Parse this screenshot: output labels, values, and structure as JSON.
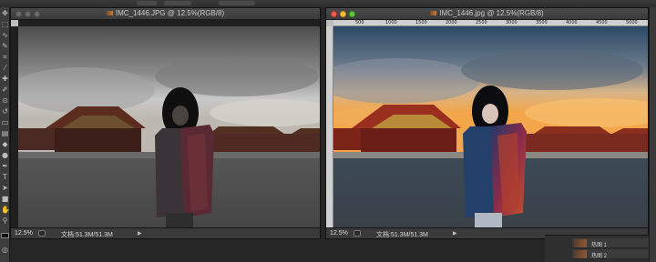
{
  "windows": {
    "left": {
      "title": "IMC_1446.JPG @ 12.5%(RGB/8)",
      "zoom": "12.5%",
      "doc_info": "文档:51.3M/51.3M"
    },
    "right": {
      "title": "IMC_1446.jpg @ 12.5%(RGB/8)",
      "zoom": "12.5%",
      "doc_info": "文档:51.3M/51.3M"
    }
  },
  "ruler_labels": [
    "500",
    "1000",
    "1500",
    "2000",
    "2500",
    "3000",
    "3500",
    "4000",
    "4500",
    "5000"
  ],
  "layers": [
    {
      "name": "热图 1",
      "icon": "layer-thumbnail"
    },
    {
      "name": "热图 2",
      "icon": "layer-thumbnail"
    }
  ],
  "tools": [
    "move-tool-icon",
    "marquee-tool-icon",
    "lasso-tool-icon",
    "quick-select-tool-icon",
    "crop-tool-icon",
    "eyedropper-tool-icon",
    "healing-tool-icon",
    "brush-tool-icon",
    "clone-tool-icon",
    "history-brush-tool-icon",
    "eraser-tool-icon",
    "gradient-tool-icon",
    "blur-tool-icon",
    "dodge-tool-icon",
    "pen-tool-icon",
    "type-tool-icon",
    "path-select-tool-icon",
    "shape-tool-icon",
    "hand-tool-icon",
    "zoom-tool-icon"
  ],
  "colors": {
    "accent_sky_warm": "#f3a64a",
    "roof_red": "#9b2f1f"
  }
}
